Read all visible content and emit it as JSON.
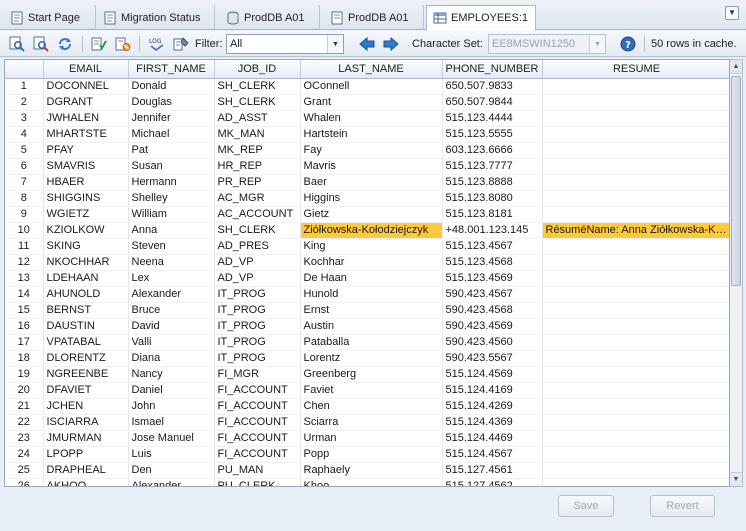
{
  "tabs": [
    {
      "label": "Start Page",
      "icon": "page-icon"
    },
    {
      "label": "Migration Status",
      "icon": "page-icon"
    },
    {
      "label": "ProdDB A01",
      "icon": "database-icon"
    },
    {
      "label": "ProdDB A01",
      "icon": "page-icon"
    },
    {
      "label": "EMPLOYEES:1",
      "icon": "table-icon"
    }
  ],
  "toolbar": {
    "filter_label": "Filter:",
    "filter_value": "All",
    "charset_label": "Character Set:",
    "charset_value": "EE8MSWIN1250",
    "rows_in_cache": "50 rows in cache."
  },
  "colors": {
    "highlight": "#ffc93c",
    "accent": "#2f6fb7"
  },
  "table": {
    "columns": [
      "",
      "EMAIL",
      "FIRST_NAME",
      "JOB_ID",
      "LAST_NAME",
      "PHONE_NUMBER",
      "RESUME"
    ],
    "rows": [
      [
        "1",
        "DOCONNEL",
        "Donald",
        "SH_CLERK",
        "OConnell",
        "650.507.9833",
        ""
      ],
      [
        "2",
        "DGRANT",
        "Douglas",
        "SH_CLERK",
        "Grant",
        "650.507.9844",
        ""
      ],
      [
        "3",
        "JWHALEN",
        "Jennifer",
        "AD_ASST",
        "Whalen",
        "515.123.4444",
        ""
      ],
      [
        "4",
        "MHARTSTE",
        "Michael",
        "MK_MAN",
        "Hartstein",
        "515.123.5555",
        ""
      ],
      [
        "5",
        "PFAY",
        "Pat",
        "MK_REP",
        "Fay",
        "603.123.6666",
        ""
      ],
      [
        "6",
        "SMAVRIS",
        "Susan",
        "HR_REP",
        "Mavris",
        "515.123.7777",
        ""
      ],
      [
        "7",
        "HBAER",
        "Hermann",
        "PR_REP",
        "Baer",
        "515.123.8888",
        ""
      ],
      [
        "8",
        "SHIGGINS",
        "Shelley",
        "AC_MGR",
        "Higgins",
        "515.123.8080",
        ""
      ],
      [
        "9",
        "WGIETZ",
        "William",
        "AC_ACCOUNT",
        "Gietz",
        "515.123.8181",
        ""
      ],
      [
        "10",
        "KZIOLKOW",
        "Anna",
        "SH_CLERK",
        "Ziółkowska-Kołodziejczyk",
        "+48.001.123.145",
        "RésuméName: Anna Ziółkowska-Kołodziejczyk"
      ],
      [
        "11",
        "SKING",
        "Steven",
        "AD_PRES",
        "King",
        "515.123.4567",
        ""
      ],
      [
        "12",
        "NKOCHHAR",
        "Neena",
        "AD_VP",
        "Kochhar",
        "515.123.4568",
        ""
      ],
      [
        "13",
        "LDEHAAN",
        "Lex",
        "AD_VP",
        "De Haan",
        "515.123.4569",
        ""
      ],
      [
        "14",
        "AHUNOLD",
        "Alexander",
        "IT_PROG",
        "Hunold",
        "590.423.4567",
        ""
      ],
      [
        "15",
        "BERNST",
        "Bruce",
        "IT_PROG",
        "Ernst",
        "590.423.4568",
        ""
      ],
      [
        "16",
        "DAUSTIN",
        "David",
        "IT_PROG",
        "Austin",
        "590.423.4569",
        ""
      ],
      [
        "17",
        "VPATABAL",
        "Valli",
        "IT_PROG",
        "Pataballa",
        "590.423.4560",
        ""
      ],
      [
        "18",
        "DLORENTZ",
        "Diana",
        "IT_PROG",
        "Lorentz",
        "590.423.5567",
        ""
      ],
      [
        "19",
        "NGREENBE",
        "Nancy",
        "FI_MGR",
        "Greenberg",
        "515.124.4569",
        ""
      ],
      [
        "20",
        "DFAVIET",
        "Daniel",
        "FI_ACCOUNT",
        "Faviet",
        "515.124.4169",
        ""
      ],
      [
        "21",
        "JCHEN",
        "John",
        "FI_ACCOUNT",
        "Chen",
        "515.124.4269",
        ""
      ],
      [
        "22",
        "ISCIARRA",
        "Ismael",
        "FI_ACCOUNT",
        "Sciarra",
        "515.124.4369",
        ""
      ],
      [
        "23",
        "JMURMAN",
        "Jose Manuel",
        "FI_ACCOUNT",
        "Urman",
        "515.124.4469",
        ""
      ],
      [
        "24",
        "LPOPP",
        "Luis",
        "FI_ACCOUNT",
        "Popp",
        "515.124.4567",
        ""
      ],
      [
        "25",
        "DRAPHEAL",
        "Den",
        "PU_MAN",
        "Raphaely",
        "515.127.4561",
        ""
      ],
      [
        "26",
        "AKHOO",
        "Alexander",
        "PU_CLERK",
        "Khoo",
        "515.127.4562",
        ""
      ]
    ],
    "highlight_row": 10
  },
  "buttons": {
    "save": "Save",
    "revert": "Revert"
  }
}
